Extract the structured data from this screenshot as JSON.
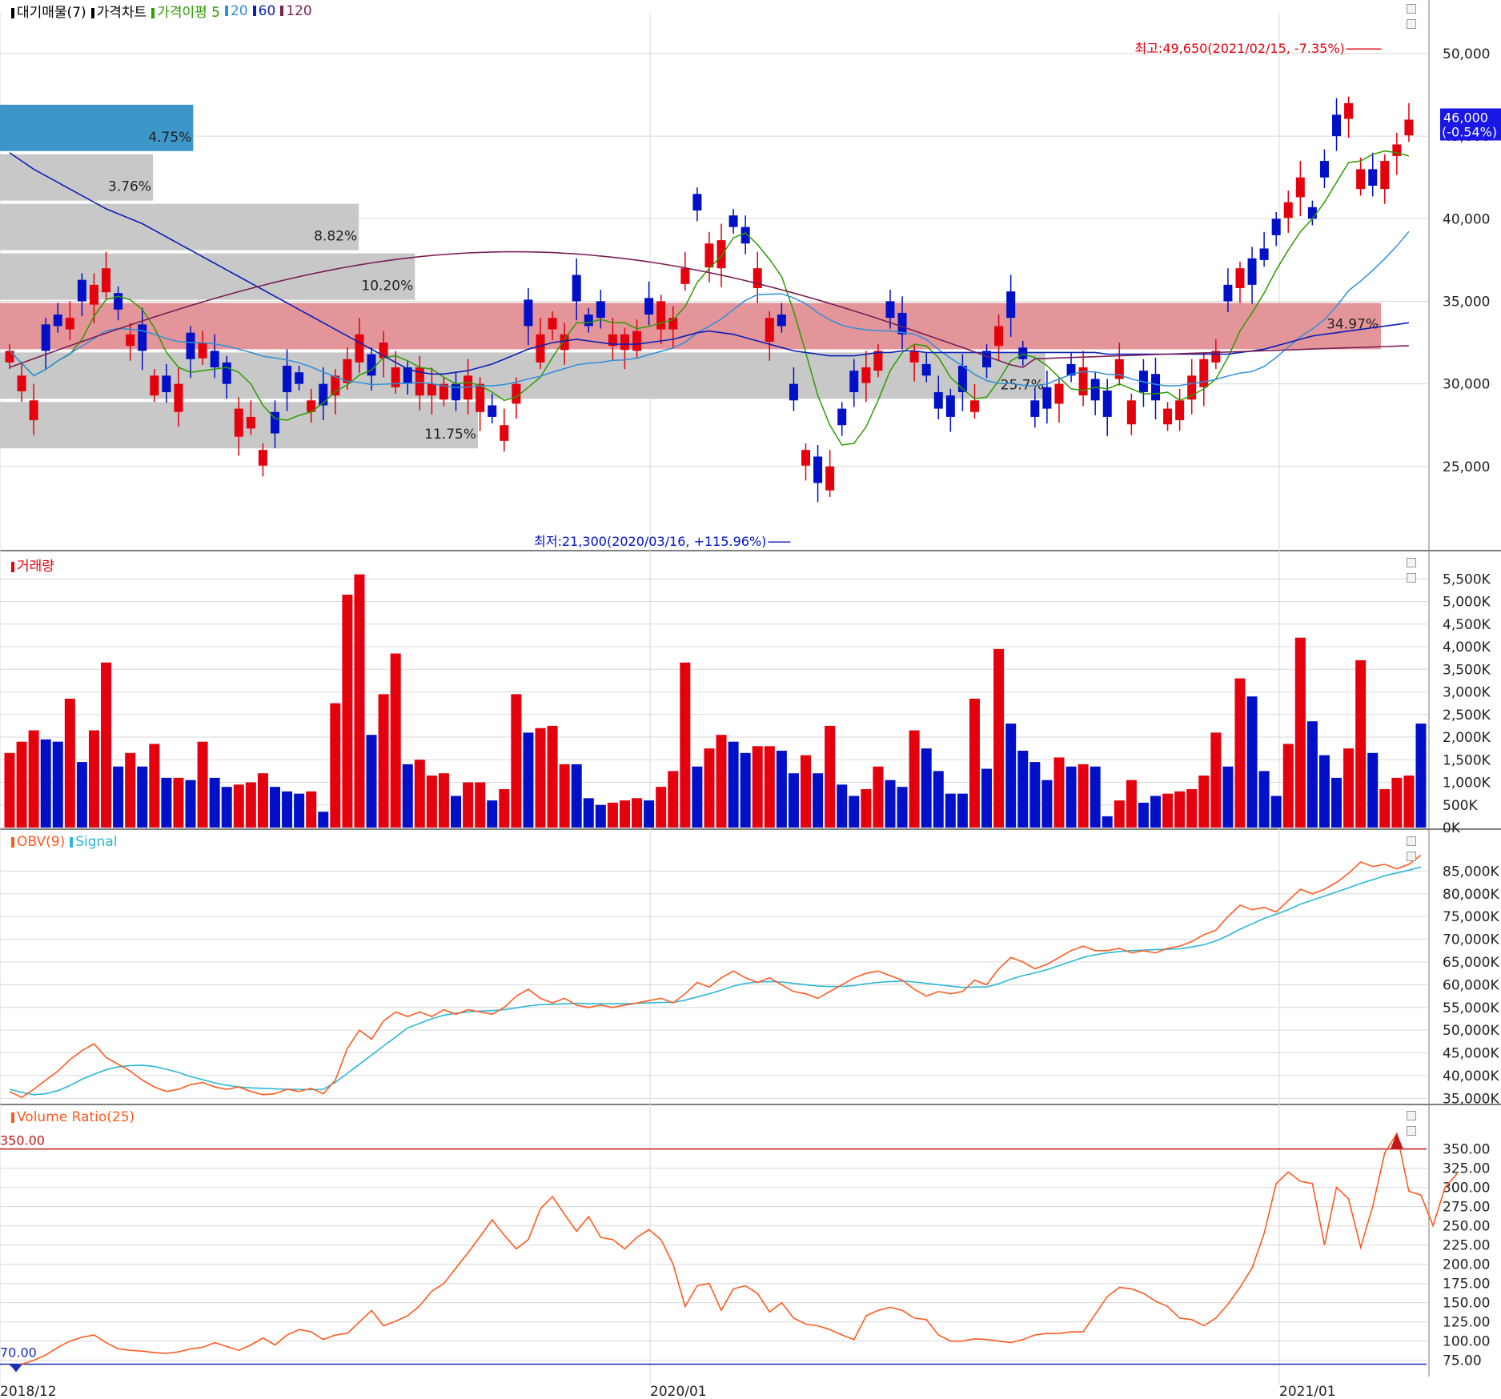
{
  "colors": {
    "up": "#e5000d",
    "down": "#0010c8",
    "ma5": "#2e9b00",
    "ma20": "#2f8fd9",
    "ma60": "#0b1fb7",
    "ma120": "#7a1f54",
    "obv": "#ff5a1f",
    "signal": "#2bb8d6",
    "vr": "#ff5a1f",
    "grid": "#d9d9d9",
    "current_price_bg": "#1a16e6",
    "highlight_zone": "#e3959a",
    "current_zone": "#3c96c8",
    "zone": "#c8c8c8"
  },
  "price_legend": {
    "items": [
      {
        "label": "대기매물(7)",
        "color": "#000000"
      },
      {
        "label": "가격차트",
        "color": "#000000"
      },
      {
        "label": "가격이평 5",
        "color": "#2e9b00"
      },
      {
        "label": "20",
        "color": "#2f8fd9"
      },
      {
        "label": "60",
        "color": "#0b1fb7"
      },
      {
        "label": "120",
        "color": "#7a1f54"
      }
    ]
  },
  "volume_legend": {
    "label": "거래량",
    "color": "#e5000d"
  },
  "obv_legend": {
    "items": [
      {
        "label": "OBV(9)",
        "color": "#ff5a1f"
      },
      {
        "label": "Signal",
        "color": "#2bb8d6"
      }
    ]
  },
  "vr_legend": {
    "label": "Volume Ratio(25)",
    "color": "#ff5a1f"
  },
  "annotations": {
    "high": "최고:49,650(2021/02/15, -7.35%)",
    "low": "최저:21,300(2020/03/16, +115.96%)",
    "current_price": "46,000",
    "current_change": "(-0.54%)",
    "vr_upper": "350.00",
    "vr_lower": "70.00"
  },
  "volume_profile": {
    "labels": [
      "4.75%",
      "3.76%",
      "8.82%",
      "10.20%",
      "34.97%",
      "25.7%",
      "11.75%"
    ]
  },
  "chart_data": [
    {
      "type": "candlestick",
      "title": "가격차트",
      "ylim": [
        20000,
        51500
      ],
      "y_ticks": [
        "50,000",
        "45,000",
        "40,000",
        "35,000",
        "30,000",
        "25,000"
      ],
      "x_ticks": [
        "2018/12",
        "2020/01",
        "2021/01"
      ],
      "high_annotation": {
        "value": 49650,
        "date": "2021/02/15",
        "pct": -7.35
      },
      "low_annotation": {
        "value": 21300,
        "date": "2020/03/16",
        "pct": 115.96
      },
      "last_price": 46000,
      "last_change_pct": -0.54,
      "series": [
        {
          "name": "5",
          "type": "line"
        },
        {
          "name": "20",
          "type": "line"
        },
        {
          "name": "60",
          "type": "line"
        },
        {
          "name": "120",
          "type": "line"
        }
      ],
      "volume_profile": [
        {
          "price_low": 44000,
          "price_high": 47000,
          "pct": 4.75,
          "current": true
        },
        {
          "price_low": 41000,
          "price_high": 44000,
          "pct": 3.76
        },
        {
          "price_low": 38000,
          "price_high": 41000,
          "pct": 8.82
        },
        {
          "price_low": 35000,
          "price_high": 38000,
          "pct": 10.2
        },
        {
          "price_low": 32000,
          "price_high": 35000,
          "pct": 34.97,
          "highlight": true
        },
        {
          "price_low": 29000,
          "price_high": 32000,
          "pct": 25.7
        },
        {
          "price_low": 26000,
          "price_high": 29000,
          "pct": 11.75
        }
      ]
    },
    {
      "type": "bar",
      "title": "거래량",
      "ylim": [
        0,
        5700
      ],
      "y_ticks": [
        "5,500K",
        "5,000K",
        "4,500K",
        "4,000K",
        "3,500K",
        "3,000K",
        "2,500K",
        "2,000K",
        "1,500K",
        "1,000K",
        "500K",
        "0K"
      ],
      "unit": "K",
      "values": [
        1650,
        1900,
        2150,
        1950,
        1900,
        2850,
        1450,
        2150,
        3650,
        1350,
        1650,
        1350,
        1850,
        1100,
        1100,
        1050,
        1900,
        1100,
        900,
        950,
        1000,
        1200,
        900,
        800,
        750,
        800,
        350,
        2750,
        5150,
        5600,
        2050,
        2950,
        3850,
        1400,
        1500,
        1150,
        1200,
        700,
        1000,
        1000,
        600,
        850,
        2950,
        2100,
        2200,
        2250,
        1400,
        1400,
        650,
        500,
        550,
        600,
        650,
        600,
        900,
        1250,
        3650,
        1350,
        1750,
        2050,
        1900,
        1650,
        1800,
        1800,
        1700,
        1200,
        1600,
        1200,
        2250,
        950,
        700,
        850,
        1350,
        1050,
        900,
        2150,
        1750,
        1250,
        750,
        750,
        2850,
        1300,
        3950,
        2300,
        1700,
        1450,
        1050,
        1550,
        1350,
        1400,
        1350,
        250,
        600,
        1050,
        550,
        700,
        750,
        800,
        850,
        1150,
        2100,
        1350,
        3300,
        2900,
        1250,
        700,
        1850,
        4200,
        2350,
        1600,
        1100,
        1750,
        3700,
        1650,
        850,
        1100,
        1150,
        2300
      ],
      "up": [
        1,
        1,
        1,
        0,
        0,
        1,
        0,
        1,
        1,
        0,
        1,
        0,
        1,
        0,
        1,
        0,
        1,
        0,
        0,
        1,
        1,
        1,
        0,
        0,
        0,
        1,
        0,
        1,
        1,
        1,
        0,
        1,
        1,
        0,
        1,
        1,
        1,
        0,
        1,
        1,
        0,
        1,
        1,
        0,
        1,
        1,
        1,
        0,
        0,
        0,
        1,
        1,
        1,
        0,
        1,
        1,
        1,
        0,
        1,
        1,
        0,
        0,
        1,
        1,
        0,
        0,
        1,
        0,
        1,
        0,
        0,
        1,
        1,
        0,
        0,
        1,
        0,
        0,
        0,
        0,
        1,
        0,
        1,
        0,
        0,
        0,
        0,
        1,
        0,
        1,
        0,
        0,
        1,
        1,
        0,
        0,
        1,
        1,
        1,
        1,
        1,
        0,
        1,
        0,
        0,
        0,
        1,
        1,
        0,
        0,
        0,
        1,
        1,
        0,
        1,
        1,
        1
      ]
    },
    {
      "type": "line",
      "title": "OBV(9)",
      "ylim": [
        34000,
        90000
      ],
      "y_ticks": [
        "85,000K",
        "80,000K",
        "75,000K",
        "70,000K",
        "65,000K",
        "60,000K",
        "55,000K",
        "50,000K",
        "45,000K",
        "40,000K",
        "35,000K"
      ],
      "unit": "K",
      "series": [
        {
          "name": "OBV(9)",
          "values": [
            36500,
            35200,
            37000,
            39000,
            41000,
            43500,
            45500,
            47000,
            44000,
            42500,
            41000,
            39000,
            37500,
            36500,
            37000,
            38000,
            38500,
            37500,
            37000,
            37500,
            36500,
            35800,
            36000,
            37000,
            36500,
            37200,
            36000,
            39000,
            46000,
            50000,
            48000,
            52000,
            54000,
            53000,
            54000,
            53000,
            54500,
            53500,
            54500,
            54000,
            53500,
            55000,
            57500,
            59000,
            57000,
            56000,
            57000,
            55500,
            55000,
            55500,
            55000,
            55500,
            56000,
            56500,
            57000,
            56000,
            58000,
            60500,
            59500,
            61500,
            63000,
            61500,
            60500,
            61500,
            60000,
            58500,
            58000,
            57000,
            58500,
            60000,
            61500,
            62500,
            63000,
            62000,
            61000,
            59000,
            57500,
            58500,
            58000,
            58500,
            61000,
            60000,
            63500,
            66000,
            65000,
            63500,
            64500,
            66000,
            67500,
            68500,
            67500,
            67500,
            68000,
            67000,
            67500,
            67000,
            68000,
            68500,
            69500,
            71000,
            72000,
            75000,
            77500,
            76500,
            77000,
            76000,
            78500,
            81000,
            80000,
            81000,
            82500,
            84500,
            87000,
            86000,
            86500,
            85500,
            86500,
            88500
          ]
        },
        {
          "name": "Signal",
          "values": [
            37000,
            36300,
            35800,
            36000,
            36700,
            37800,
            39200,
            40300,
            41300,
            41900,
            42200,
            42300,
            42000,
            41400,
            40700,
            39800,
            39100,
            38400,
            37900,
            37500,
            37300,
            37200,
            37100,
            37000,
            37000,
            36900,
            37000,
            38500,
            40500,
            42500,
            44500,
            46500,
            48500,
            50500,
            51500,
            52500,
            53300,
            53700,
            54000,
            54200,
            54300,
            54500,
            54900,
            55300,
            55600,
            55700,
            55800,
            55900,
            55800,
            55800,
            55800,
            55800,
            55900,
            56000,
            56100,
            56100,
            56600,
            57300,
            58000,
            58800,
            59700,
            60300,
            60600,
            60700,
            60600,
            60300,
            60000,
            59700,
            59600,
            59600,
            59800,
            60200,
            60500,
            60700,
            60800,
            60600,
            60300,
            60000,
            59700,
            59400,
            59500,
            59500,
            60200,
            61200,
            62000,
            62600,
            63300,
            64200,
            65100,
            66000,
            66600,
            67000,
            67300,
            67500,
            67600,
            67700,
            67800,
            67900,
            68300,
            68800,
            69600,
            70800,
            72200,
            73400,
            74600,
            75500,
            76500,
            77700,
            78600,
            79500,
            80400,
            81300,
            82300,
            83100,
            84000,
            84600,
            85200,
            85900
          ]
        }
      ]
    },
    {
      "type": "line",
      "title": "Volume Ratio(25)",
      "ylim": [
        58,
        385
      ],
      "y_ticks": [
        "350.00",
        "325.00",
        "300.00",
        "275.00",
        "250.00",
        "225.00",
        "200.00",
        "175.00",
        "150.00",
        "125.00",
        "100.00",
        "75.00"
      ],
      "reference_lines": [
        350,
        70
      ],
      "series": [
        {
          "name": "Volume Ratio(25)",
          "values": [
            68,
            70,
            75,
            82,
            92,
            100,
            105,
            108,
            98,
            90,
            88,
            87,
            85,
            84,
            86,
            90,
            92,
            98,
            93,
            88,
            95,
            104,
            95,
            108,
            115,
            112,
            102,
            108,
            110,
            125,
            140,
            120,
            126,
            133,
            146,
            165,
            175,
            195,
            215,
            236,
            258,
            238,
            220,
            232,
            272,
            288,
            265,
            243,
            262,
            235,
            232,
            220,
            235,
            245,
            232,
            200,
            145,
            172,
            175,
            140,
            168,
            172,
            162,
            138,
            150,
            130,
            122,
            120,
            115,
            108,
            102,
            133,
            140,
            144,
            140,
            130,
            128,
            108,
            100,
            100,
            103,
            102,
            100,
            98,
            102,
            108,
            110,
            110,
            112,
            112,
            135,
            158,
            170,
            168,
            162,
            152,
            145,
            130,
            128,
            120,
            130,
            148,
            170,
            195,
            240,
            305,
            320,
            308,
            305,
            225,
            300,
            285,
            222,
            275,
            345,
            370,
            295,
            290,
            250,
            300,
            318
          ]
        }
      ]
    }
  ]
}
